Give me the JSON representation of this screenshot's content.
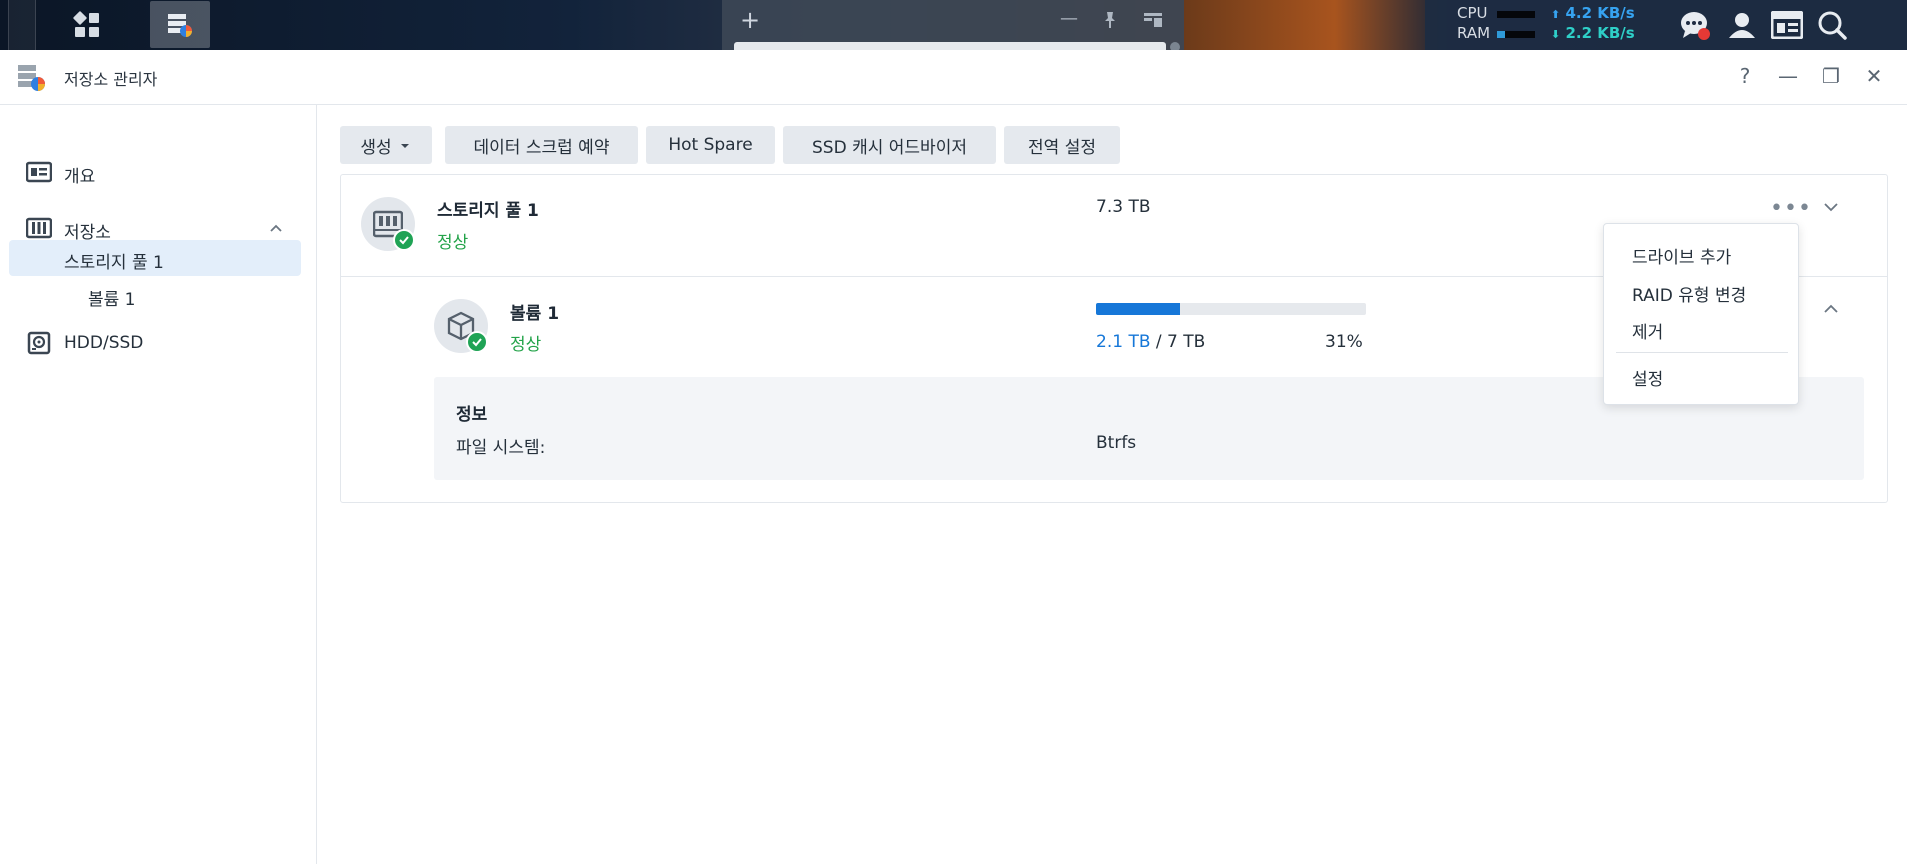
{
  "taskbar": {
    "cpu_label": "CPU",
    "ram_label": "RAM",
    "cpu_fill": 0.0,
    "ram_fill": 0.2,
    "upload": "4.2 KB/s",
    "download": "2.2 KB/s",
    "up_arrow": "⬆",
    "down_arrow": "⬇",
    "colors": {
      "upload": "#36a3f0",
      "download": "#2ecfc8",
      "notification": "#e53935"
    }
  },
  "window": {
    "title": "저장소 관리자",
    "controls": {
      "help": "?",
      "minimize": "—",
      "restore": "❐",
      "close": "✕"
    }
  },
  "sidebar": {
    "items": [
      {
        "label": "개요",
        "icon": "overview-icon"
      },
      {
        "label": "저장소",
        "icon": "storage-icon",
        "expanded": true
      },
      {
        "label": "스토리지 풀 1",
        "selected": true
      },
      {
        "label": "볼륨 1"
      },
      {
        "label": "HDD/SSD",
        "icon": "hdd-icon"
      }
    ]
  },
  "toolbar": {
    "create": "생성",
    "data_scrub": "데이터 스크럽 예약",
    "hot_spare": "Hot Spare",
    "ssd_cache": "SSD 캐시 어드바이저",
    "global_settings": "전역 설정"
  },
  "pool": {
    "name": "스토리지 풀 1",
    "status": "정상",
    "size": "7.3 TB"
  },
  "volume": {
    "name": "볼륨 1",
    "status": "정상",
    "used": "2.1 TB",
    "separator": " / ",
    "total": "7 TB",
    "percent": "31%",
    "percent_value": 31,
    "info_title": "정보",
    "fs_label": "파일 시스템:",
    "fs_value": "Btrfs"
  },
  "menu": {
    "items": [
      "드라이브 추가",
      "RAID 유형 변경",
      "제거",
      "설정"
    ]
  },
  "colors": {
    "accent": "#1677d8",
    "status_ok": "#23a349",
    "selected_bg": "#e3eefa"
  }
}
